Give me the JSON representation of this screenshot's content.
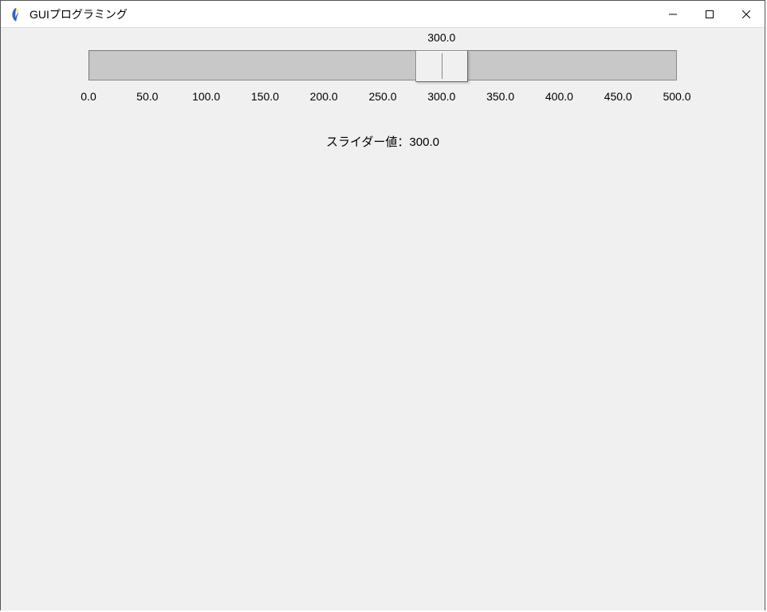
{
  "window": {
    "title": "GUIプログラミング"
  },
  "slider": {
    "min": 0.0,
    "max": 500.0,
    "value": 300.0,
    "current_value_text": "300.0",
    "ticks": [
      "0.0",
      "50.0",
      "100.0",
      "150.0",
      "200.0",
      "250.0",
      "300.0",
      "350.0",
      "400.0",
      "450.0",
      "500.0"
    ]
  },
  "label": {
    "prefix": "スライダー値：",
    "value": "300.0"
  }
}
